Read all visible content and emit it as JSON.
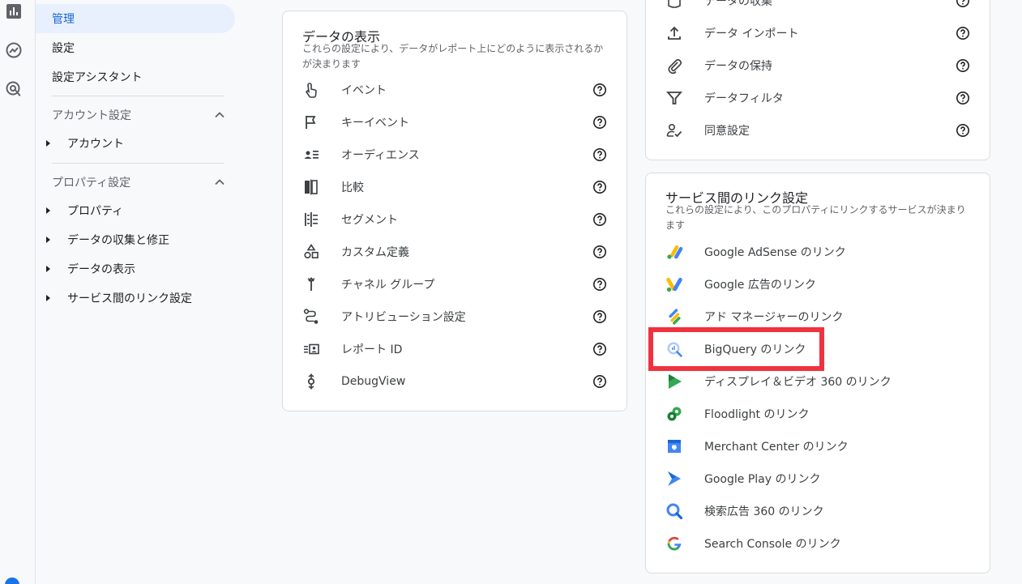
{
  "rail": {
    "icons": [
      "reports-icon",
      "explore-icon",
      "advertising-icon"
    ]
  },
  "nav": {
    "admin": "管理",
    "settings": "設定",
    "setup_assistant": "設定アシスタント",
    "account_section": "アカウント設定",
    "account": "アカウント",
    "property_section": "プロパティ設定",
    "property": "プロパティ",
    "data_collection": "データの収集と修正",
    "data_display": "データの表示",
    "product_links": "サービス間のリンク設定"
  },
  "data_display_card": {
    "title": "データの表示",
    "description": "これらの設定により、データがレポート上にどのように表示されるかが決まります",
    "items": [
      {
        "label": "イベント",
        "icon": "touch-icon"
      },
      {
        "label": "キーイベント",
        "icon": "flag-icon"
      },
      {
        "label": "オーディエンス",
        "icon": "audience-icon"
      },
      {
        "label": "比較",
        "icon": "compare-icon"
      },
      {
        "label": "セグメント",
        "icon": "segment-icon"
      },
      {
        "label": "カスタム定義",
        "icon": "shapes-icon"
      },
      {
        "label": "チャネル グループ",
        "icon": "merge-icon"
      },
      {
        "label": "アトリビューション設定",
        "icon": "route-icon"
      },
      {
        "label": "レポート ID",
        "icon": "report-id-icon"
      },
      {
        "label": "DebugView",
        "icon": "debug-icon"
      }
    ]
  },
  "data_collection_card": {
    "items": [
      {
        "label": "データの収集",
        "icon": "database-icon"
      },
      {
        "label": "データ インポート",
        "icon": "upload-icon"
      },
      {
        "label": "データの保持",
        "icon": "attachment-icon"
      },
      {
        "label": "データフィルタ",
        "icon": "filter-icon"
      },
      {
        "label": "同意設定",
        "icon": "consent-icon"
      }
    ]
  },
  "product_links_card": {
    "title": "サービス間のリンク設定",
    "description": "これらの設定により、このプロパティにリンクするサービスが決まります",
    "items": [
      {
        "label": "Google AdSense のリンク",
        "icon": "adsense-icon"
      },
      {
        "label": "Google 広告のリンク",
        "icon": "google-ads-icon"
      },
      {
        "label": "アド マネージャーのリンク",
        "icon": "ad-manager-icon"
      },
      {
        "label": "BigQuery のリンク",
        "icon": "bigquery-icon"
      },
      {
        "label": "ディスプレイ＆ビデオ 360 のリンク",
        "icon": "dv360-icon"
      },
      {
        "label": "Floodlight のリンク",
        "icon": "floodlight-icon"
      },
      {
        "label": "Merchant Center のリンク",
        "icon": "merchant-center-icon"
      },
      {
        "label": "Google Play のリンク",
        "icon": "google-play-icon"
      },
      {
        "label": "検索広告 360 のリンク",
        "icon": "search-ads-360-icon"
      },
      {
        "label": "Search Console のリンク",
        "icon": "search-console-icon"
      }
    ]
  },
  "colors": {
    "accent": "#1967d2",
    "highlight": "#f0323e",
    "google_blue": "#4285f4",
    "google_green": "#34a853",
    "google_yellow": "#fbbc04",
    "google_red": "#ea4335"
  }
}
